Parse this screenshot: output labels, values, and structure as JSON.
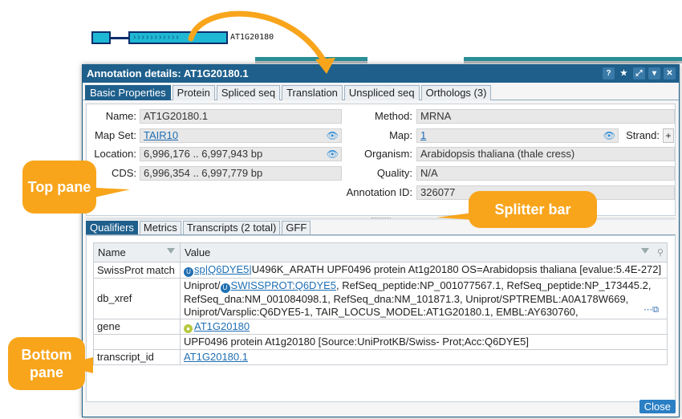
{
  "gene_label": "AT1G20180",
  "window": {
    "title": "Annotation details: AT1G20180.1",
    "top_tabs": [
      "Basic Properties",
      "Protein",
      "Spliced seq",
      "Translation",
      "Unspliced seq",
      "Orthologs (3)"
    ],
    "bottom_tabs": [
      "Qualifiers",
      "Metrics",
      "Transcripts (2 total)",
      "GFF"
    ],
    "close_label": "Close"
  },
  "fields": {
    "name_label": "Name:",
    "name": "AT1G20180.1",
    "mapset_label": "Map Set:",
    "mapset": "TAIR10",
    "location_label": "Location:",
    "location": "6,996,176 .. 6,997,943 bp",
    "cds_label": "CDS:",
    "cds": "6,996,354 .. 6,997,779 bp",
    "method_label": "Method:",
    "method": "MRNA",
    "map_label": "Map:",
    "map": "1",
    "strand_label": "Strand:",
    "strand": "+",
    "organism_label": "Organism:",
    "organism": "Arabidopsis thaliana (thale cress)",
    "quality_label": "Quality:",
    "quality": "N/A",
    "annotation_id_label": "Annotation ID:",
    "annotation_id": "326077"
  },
  "grid": {
    "col_name": "Name",
    "col_value": "Value",
    "rows": {
      "swissprot": {
        "name": "SwissProt match",
        "link": "sp|Q6DYE5|",
        "text": "U496K_ARATH UPF0496 protein At1g20180 OS=Arabidopsis thaliana [evalue:5.4E-272]"
      },
      "dbxref": {
        "name": "db_xref",
        "prefix": "Uniprot/",
        "link": "SWISSPROT:Q6DYE5",
        "text": ", RefSeq_peptide:NP_001077567.1, RefSeq_peptide:NP_173445.2, RefSeq_dna:NM_001084098.1, RefSeq_dna:NM_101871.3, Uniprot/SPTREMBL:A0A178W669, Uniprot/Varsplic:Q6DYE5-1, TAIR_LOCUS_MODEL:AT1G20180.1, EMBL:AY630760,"
      },
      "gene": {
        "name": "gene",
        "link": "AT1G20180"
      },
      "note": {
        "name": "",
        "text": "UPF0496 protein At1g20180 [Source:UniProtKB/Swiss- Prot;Acc:Q6DYE5]"
      },
      "transcript": {
        "name": "transcript_id",
        "link": "AT1G20180.1"
      }
    }
  },
  "callouts": {
    "top_pane": "Top pane",
    "splitter": "Splitter bar",
    "bottom_pane": "Bottom pane"
  },
  "colors": {
    "accent": "#1e5f8c",
    "callout": "#f8a51c",
    "link": "#1f6fb3"
  }
}
